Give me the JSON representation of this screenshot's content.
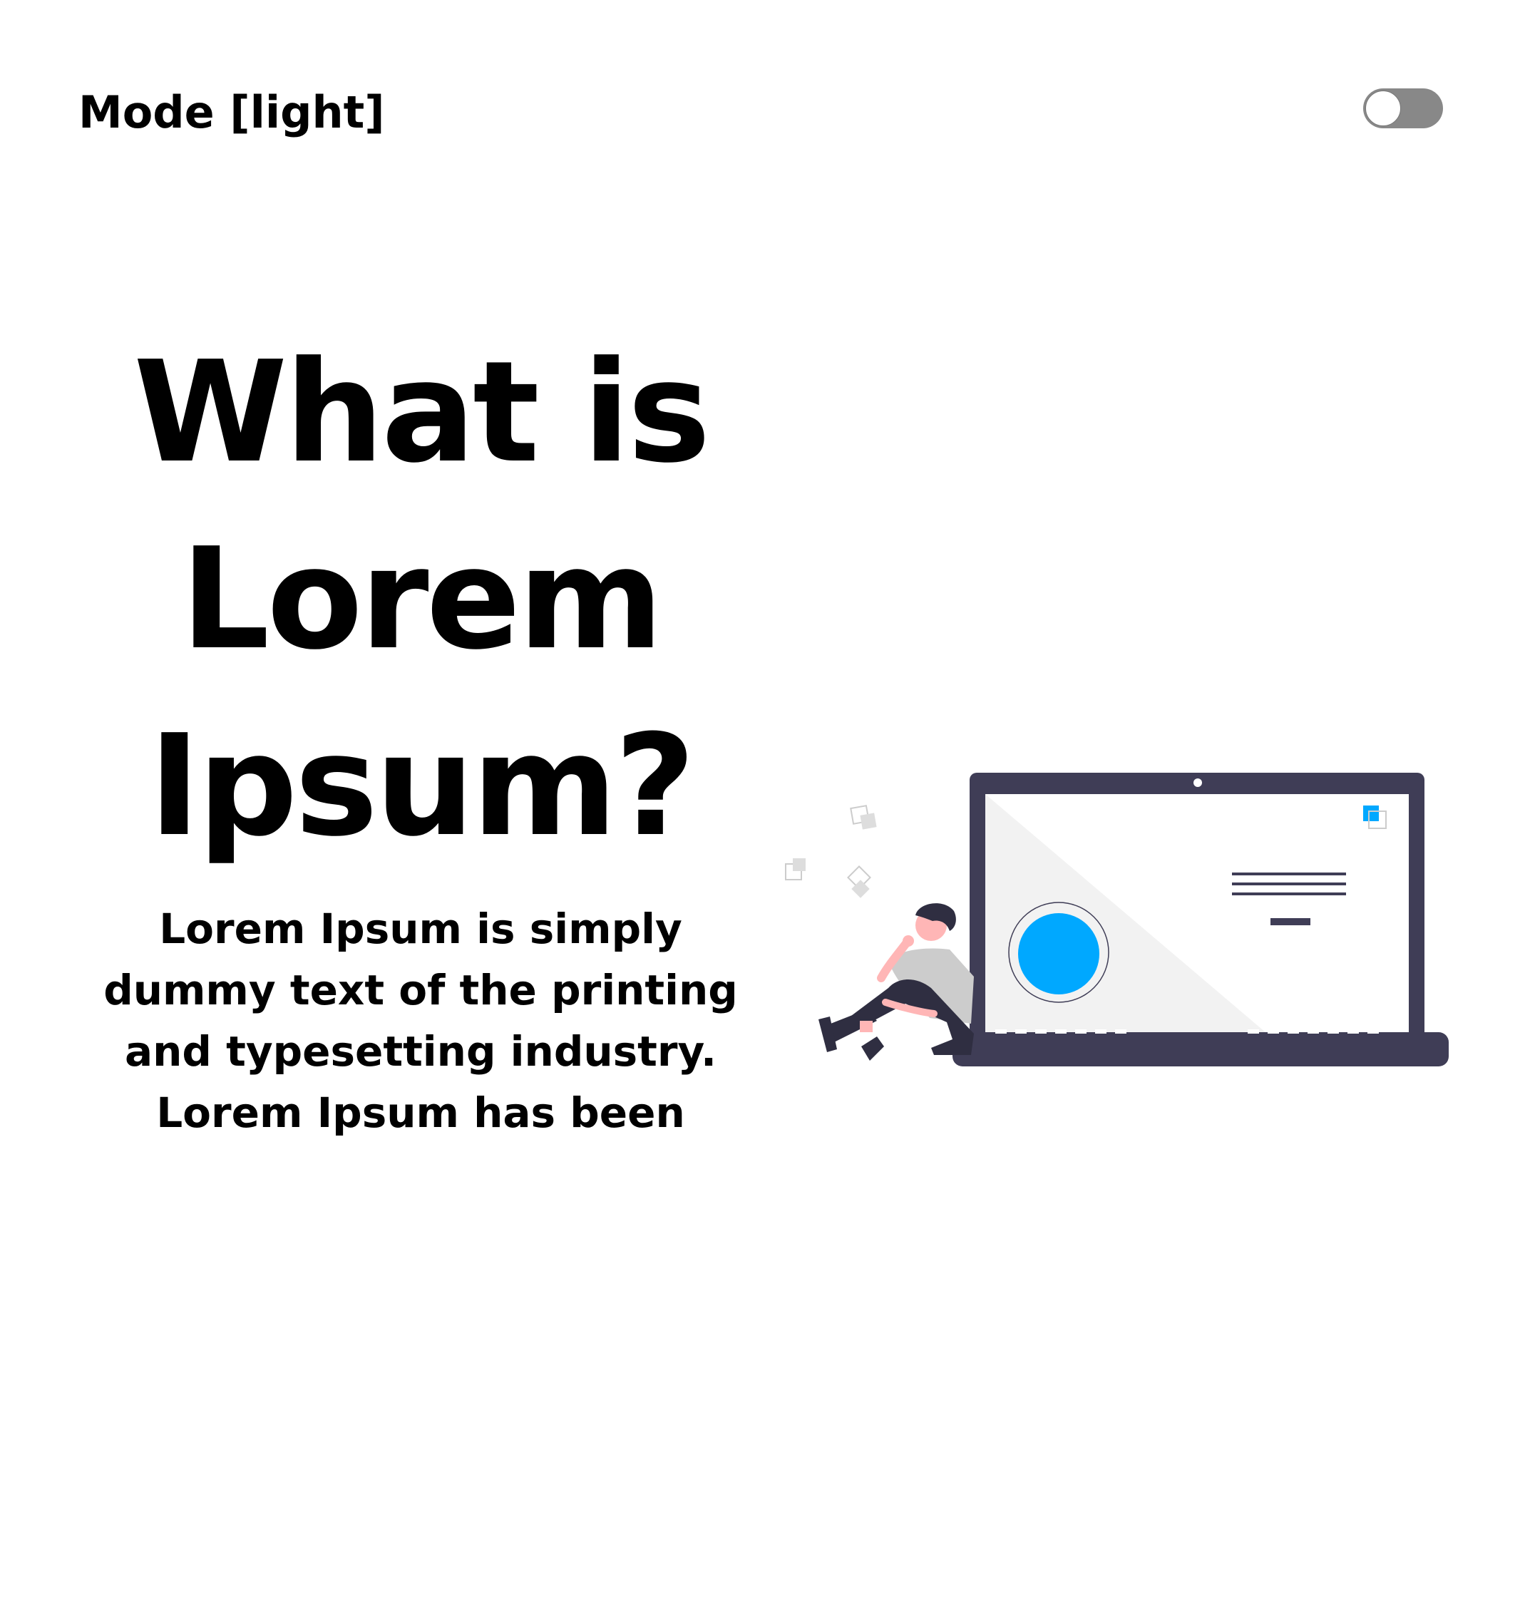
{
  "header": {
    "mode_label": "Mode [light]",
    "theme_toggle": {
      "on": false,
      "track_color": "#888888",
      "knob_color": "#ffffff"
    }
  },
  "hero": {
    "title": "What is Lorem Ipsum?",
    "description": "Lorem Ipsum is simply dummy text of the printing and typesetting industry. Lorem Ipsum has been"
  },
  "illustration": {
    "kind": "person-with-laptop-icon",
    "colors": {
      "laptop": "#3f3d56",
      "accent": "#00a8ff",
      "skin": "#ffb6b6",
      "shirt": "#cccccc",
      "screen_shape": "#f2f2f2"
    }
  }
}
